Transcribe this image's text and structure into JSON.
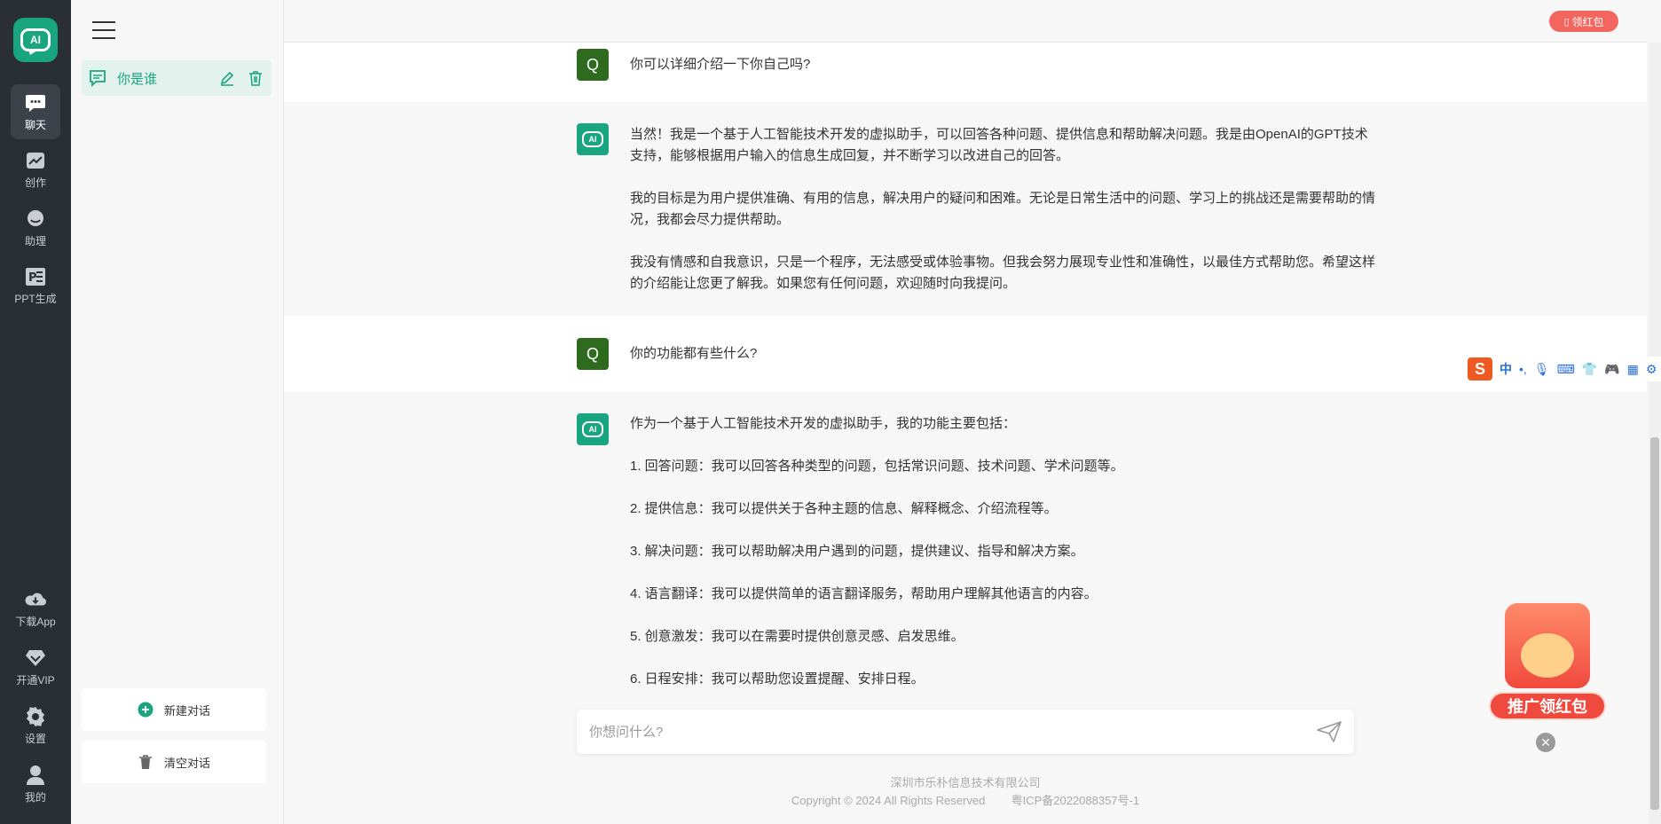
{
  "rail": {
    "logo_text": "AI",
    "items": [
      {
        "label": "聊天",
        "icon": "chat-icon"
      },
      {
        "label": "创作",
        "icon": "chart-icon"
      },
      {
        "label": "助理",
        "icon": "assistant-icon"
      },
      {
        "label": "PPT生成",
        "icon": "ppt-icon"
      }
    ],
    "bottom": [
      {
        "label": "下载App",
        "icon": "download-icon"
      },
      {
        "label": "开通VIP",
        "icon": "diamond-icon"
      },
      {
        "label": "设置",
        "icon": "gear-icon"
      },
      {
        "label": "我的",
        "icon": "user-icon"
      }
    ]
  },
  "sidebar": {
    "conversations": [
      {
        "title": "你是谁"
      }
    ],
    "new_chat": "新建对话",
    "clear_chat": "清空对话"
  },
  "topbar": {
    "redpacket": "领红包"
  },
  "messages": [
    {
      "role": "user",
      "avatar": "Q",
      "text": "你可以详细介绍一下你自己吗?"
    },
    {
      "role": "bot",
      "paragraphs": [
        "当然！我是一个基于人工智能技术开发的虚拟助手，可以回答各种问题、提供信息和帮助解决问题。我是由OpenAI的GPT技术支持，能够根据用户输入的信息生成回复，并不断学习以改进自己的回答。",
        "我的目标是为用户提供准确、有用的信息，解决用户的疑问和困难。无论是日常生活中的问题、学习上的挑战还是需要帮助的情况，我都会尽力提供帮助。",
        "我没有情感和自我意识，只是一个程序，无法感受或体验事物。但我会努力展现专业性和准确性，以最佳方式帮助您。希望这样的介绍能让您更了解我。如果您有任何问题，欢迎随时向我提问。"
      ]
    },
    {
      "role": "user",
      "avatar": "Q",
      "text": "你的功能都有些什么?"
    },
    {
      "role": "bot",
      "paragraphs": [
        "作为一个基于人工智能技术开发的虚拟助手，我的功能主要包括：",
        "1. 回答问题：我可以回答各种类型的问题，包括常识问题、技术问题、学术问题等。",
        "2. 提供信息：我可以提供关于各种主题的信息、解释概念、介绍流程等。",
        "3. 解决问题：我可以帮助解决用户遇到的问题，提供建议、指导和解决方案。",
        "4. 语言翻译：我可以提供简单的语言翻译服务，帮助用户理解其他语言的内容。",
        "5. 创意激发：我可以在需要时提供创意灵感、启发思维。",
        "6. 日程安排：我可以帮助您设置提醒、安排日程。"
      ]
    }
  ],
  "input": {
    "placeholder": "你想问什么?"
  },
  "footer": {
    "company": "深圳市乐朴信息技术有限公司",
    "copyright": "Copyright © 2024 All Rights Reserved",
    "icp": "粤ICP备2022088357号-1"
  },
  "ime": {
    "logo": "S",
    "mode": "中"
  },
  "promo": {
    "label": "推广领红包"
  },
  "colors": {
    "brand": "#19a57f",
    "rail_bg": "#2a2e35",
    "user_avatar": "#2f6b1e",
    "red": "#f3655f"
  }
}
